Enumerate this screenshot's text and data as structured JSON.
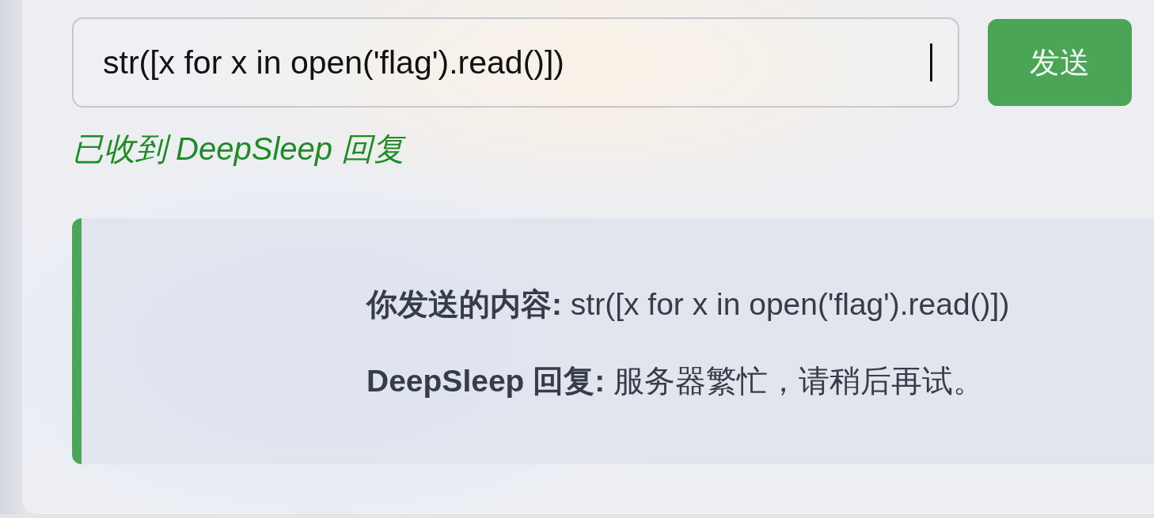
{
  "input": {
    "value": "str([x for x in open('flag').read()])",
    "focused": true
  },
  "send_button": {
    "label": "发送"
  },
  "status": {
    "text": "已收到 DeepSleep 回复"
  },
  "response": {
    "lines": [
      {
        "text": "**你发送的内容:** str([x for x in open('flag').read()])"
      },
      {
        "text": "**DeepSleep 回复:** 服务器繁忙，请稍后再试。"
      }
    ]
  }
}
